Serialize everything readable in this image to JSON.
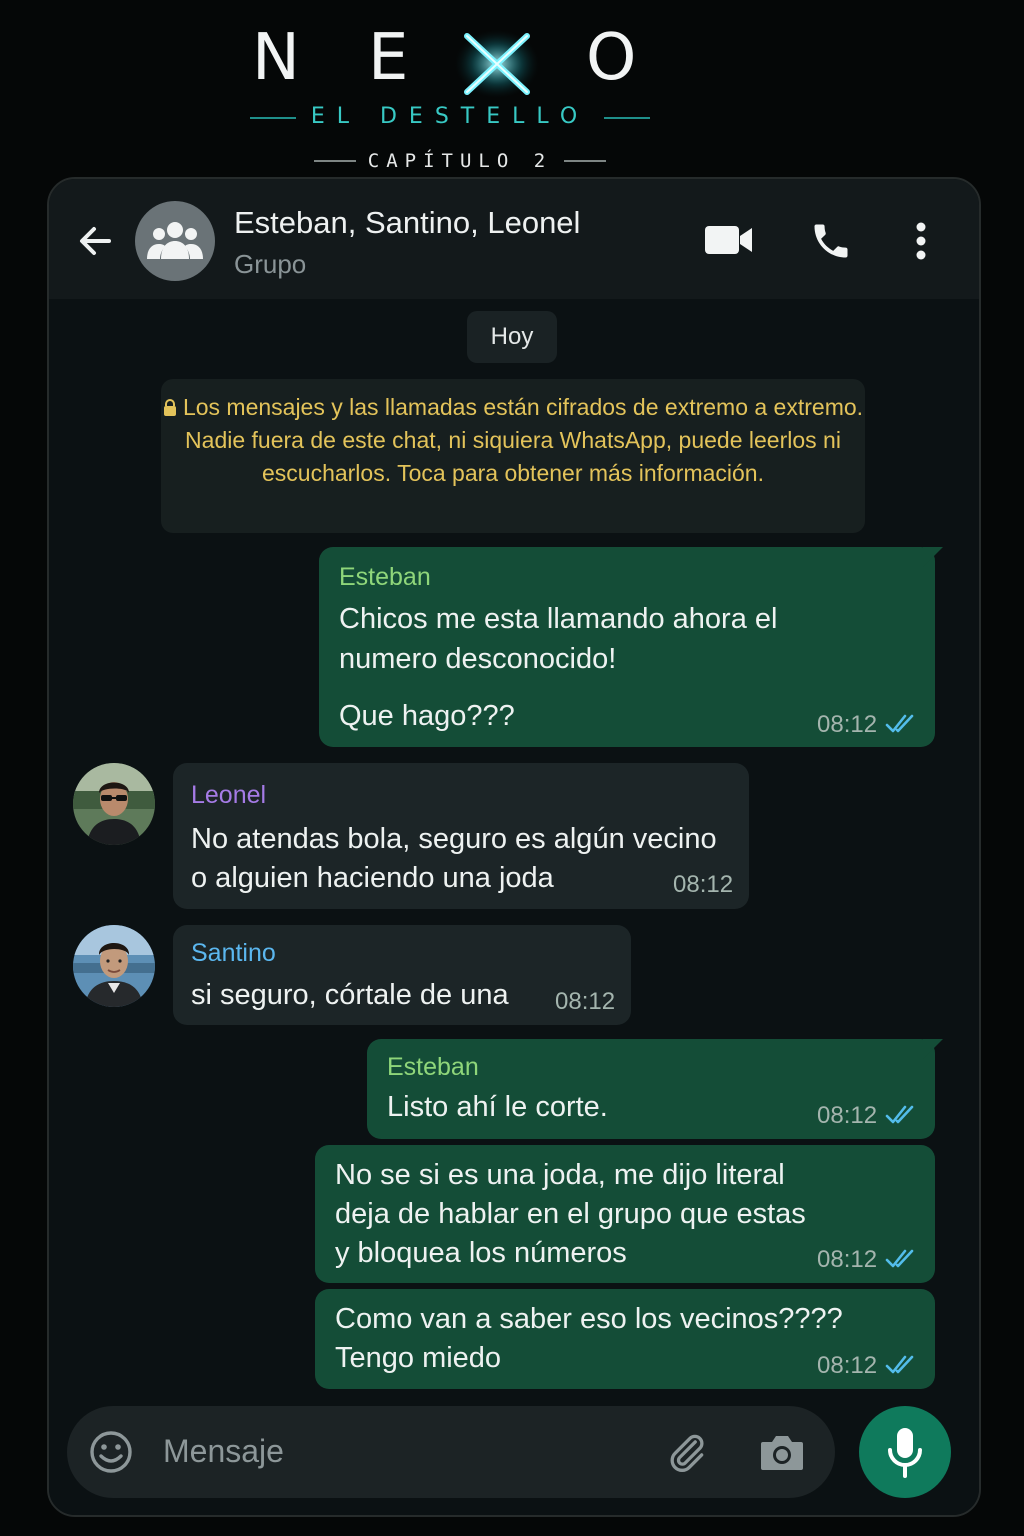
{
  "brand": {
    "letters": [
      "N",
      "E",
      "O"
    ],
    "subtitle": "EL DESTELLO",
    "chapter": "CAPÍTULO 2"
  },
  "header": {
    "title": "Esteban, Santino, Leonel",
    "subtitle": "Grupo",
    "icons": [
      "back-arrow-icon",
      "group-avatar-icon",
      "video-call-icon",
      "phone-call-icon",
      "more-options-icon"
    ]
  },
  "chat": {
    "date_label": "Hoy",
    "encryption_notice": "Los mensajes y las llamadas están cifrados de extremo a extremo. Nadie fuera de este chat, ni siquiera WhatsApp, puede leerlos ni escucharlos. Toca para obtener más información.",
    "messages": [
      {
        "direction": "out",
        "sender": "Esteban",
        "text_lines": [
          "Chicos me esta llamando ahora el",
          "numero desconocido!"
        ],
        "text_extra": "Que hago???",
        "time": "08:12",
        "status": "read"
      },
      {
        "direction": "in",
        "sender": "Leonel",
        "text_lines": [
          "No atendas bola, seguro es algún vecino",
          "o alguien haciendo una joda"
        ],
        "time": "08:12"
      },
      {
        "direction": "in",
        "sender": "Santino",
        "text_lines": [
          "si seguro, córtale de una"
        ],
        "time": "08:12"
      },
      {
        "direction": "out",
        "sender": "Esteban",
        "text_lines": [
          "Listo ahí le corte."
        ],
        "time": "08:12",
        "status": "read"
      },
      {
        "direction": "out",
        "text_lines": [
          "No se si es una joda, me dijo literal",
          "deja de hablar en el grupo que estas",
          "y bloquea los números"
        ],
        "time": "08:12",
        "status": "read"
      },
      {
        "direction": "out",
        "text_lines": [
          "Como van a saber eso los vecinos????",
          "Tengo miedo"
        ],
        "time": "08:12",
        "status": "read"
      }
    ]
  },
  "composer": {
    "placeholder": "Mensaje"
  },
  "colors": {
    "outgoing_bubble": "#144d37",
    "incoming_bubble": "#1c2527",
    "esteban_name": "#8fd67a",
    "leonel_name": "#a57be6",
    "santino_name": "#5bb7ef",
    "notice_text": "#e3c35a",
    "read_ticks": "#53bdeb",
    "mic_button": "#0f7a5c"
  }
}
